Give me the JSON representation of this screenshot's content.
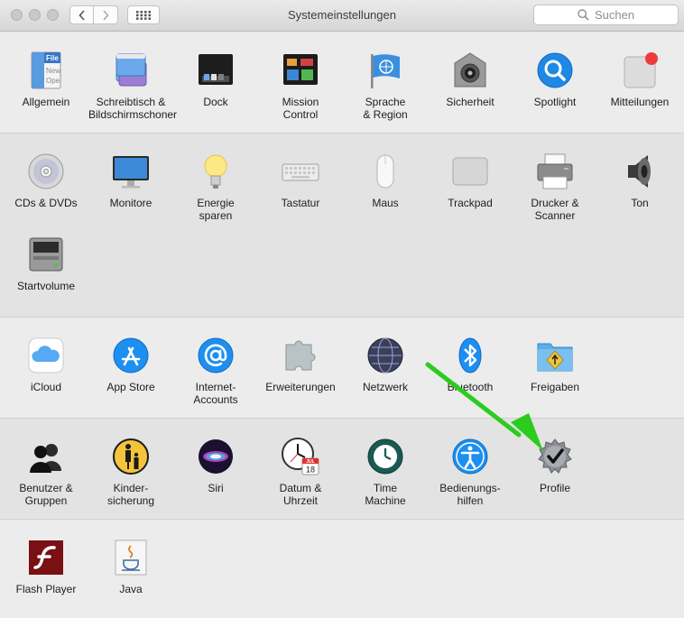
{
  "window": {
    "title": "Systemeinstellungen",
    "search_placeholder": "Suchen"
  },
  "sections": [
    {
      "items": [
        {
          "label": "Allgemein",
          "icon": "general-icon"
        },
        {
          "label": "Schreibtisch &\nBildschirmschoner",
          "icon": "desktop-screensaver-icon"
        },
        {
          "label": "Dock",
          "icon": "dock-icon"
        },
        {
          "label": "Mission\nControl",
          "icon": "mission-control-icon"
        },
        {
          "label": "Sprache\n& Region",
          "icon": "language-region-icon"
        },
        {
          "label": "Sicherheit",
          "icon": "security-icon"
        },
        {
          "label": "Spotlight",
          "icon": "spotlight-icon"
        },
        {
          "label": "Mitteilungen",
          "icon": "notifications-icon"
        }
      ]
    },
    {
      "items": [
        {
          "label": "CDs & DVDs",
          "icon": "cd-dvd-icon"
        },
        {
          "label": "Monitore",
          "icon": "displays-icon"
        },
        {
          "label": "Energie\nsparen",
          "icon": "energy-saver-icon"
        },
        {
          "label": "Tastatur",
          "icon": "keyboard-icon"
        },
        {
          "label": "Maus",
          "icon": "mouse-icon"
        },
        {
          "label": "Trackpad",
          "icon": "trackpad-icon"
        },
        {
          "label": "Drucker &\nScanner",
          "icon": "printer-icon"
        },
        {
          "label": "Ton",
          "icon": "sound-icon"
        },
        {
          "label": "Startvolume",
          "icon": "startup-disk-icon"
        }
      ]
    },
    {
      "items": [
        {
          "label": "iCloud",
          "icon": "icloud-icon"
        },
        {
          "label": "App Store",
          "icon": "app-store-icon"
        },
        {
          "label": "Internet-\nAccounts",
          "icon": "internet-accounts-icon"
        },
        {
          "label": "Erweiterungen",
          "icon": "extensions-icon"
        },
        {
          "label": "Netzwerk",
          "icon": "network-icon"
        },
        {
          "label": "Bluetooth",
          "icon": "bluetooth-icon"
        },
        {
          "label": "Freigaben",
          "icon": "sharing-icon"
        }
      ]
    },
    {
      "items": [
        {
          "label": "Benutzer &\nGruppen",
          "icon": "users-groups-icon"
        },
        {
          "label": "Kinder-\nsicherung",
          "icon": "parental-controls-icon"
        },
        {
          "label": "Siri",
          "icon": "siri-icon"
        },
        {
          "label": "Datum &\nUhrzeit",
          "icon": "date-time-icon"
        },
        {
          "label": "Time\nMachine",
          "icon": "time-machine-icon"
        },
        {
          "label": "Bedienungs-\nhilfen",
          "icon": "accessibility-icon"
        },
        {
          "label": "Profile",
          "icon": "profiles-icon"
        }
      ]
    },
    {
      "items": [
        {
          "label": "Flash Player",
          "icon": "flash-player-icon"
        },
        {
          "label": "Java",
          "icon": "java-icon"
        }
      ]
    }
  ],
  "icon_texts": {
    "general_file": "File",
    "general_new": "New",
    "general_open": "Ope",
    "calendar_month": "JUL",
    "calendar_day": "18"
  },
  "annotation": {
    "arrow_color": "#2bcc1e"
  }
}
